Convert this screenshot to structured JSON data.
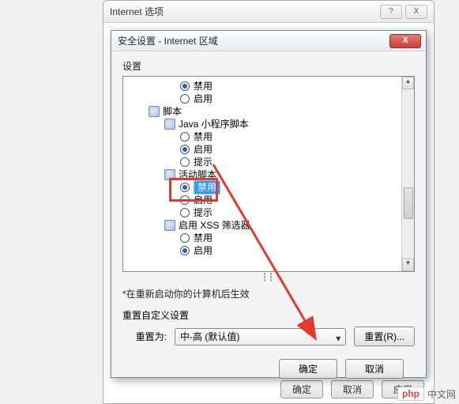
{
  "parent": {
    "title": "Internet 选项",
    "buttons": {
      "help": "?",
      "close": "X",
      "ok": "确定",
      "cancel": "取消",
      "apply": "应用"
    }
  },
  "dialog": {
    "title": "安全设置 - Internet 区域",
    "close": "X",
    "settings_label": "设置",
    "tree": {
      "r1": "禁用",
      "r2": "启用",
      "g1": "脚本",
      "g1a": "Java 小程序脚本",
      "r3": "禁用",
      "r4": "启用",
      "r5": "提示",
      "g1b": "活动脚本",
      "r6": "禁用",
      "r7": "启用",
      "r8": "提示",
      "g1c": "启用 XSS 筛选器",
      "r9": "禁用",
      "r10": "启用"
    },
    "note": "*在重新启动你的计算机后生效",
    "reset_section": "重置自定义设置",
    "reset_to": "重置为:",
    "reset_value": "中-高 (默认值)",
    "reset_btn": "重置(R)...",
    "ok": "确定",
    "cancel": "取消"
  },
  "watermark": {
    "brand_prefix": "php",
    "brand_suffix": "中文网"
  }
}
